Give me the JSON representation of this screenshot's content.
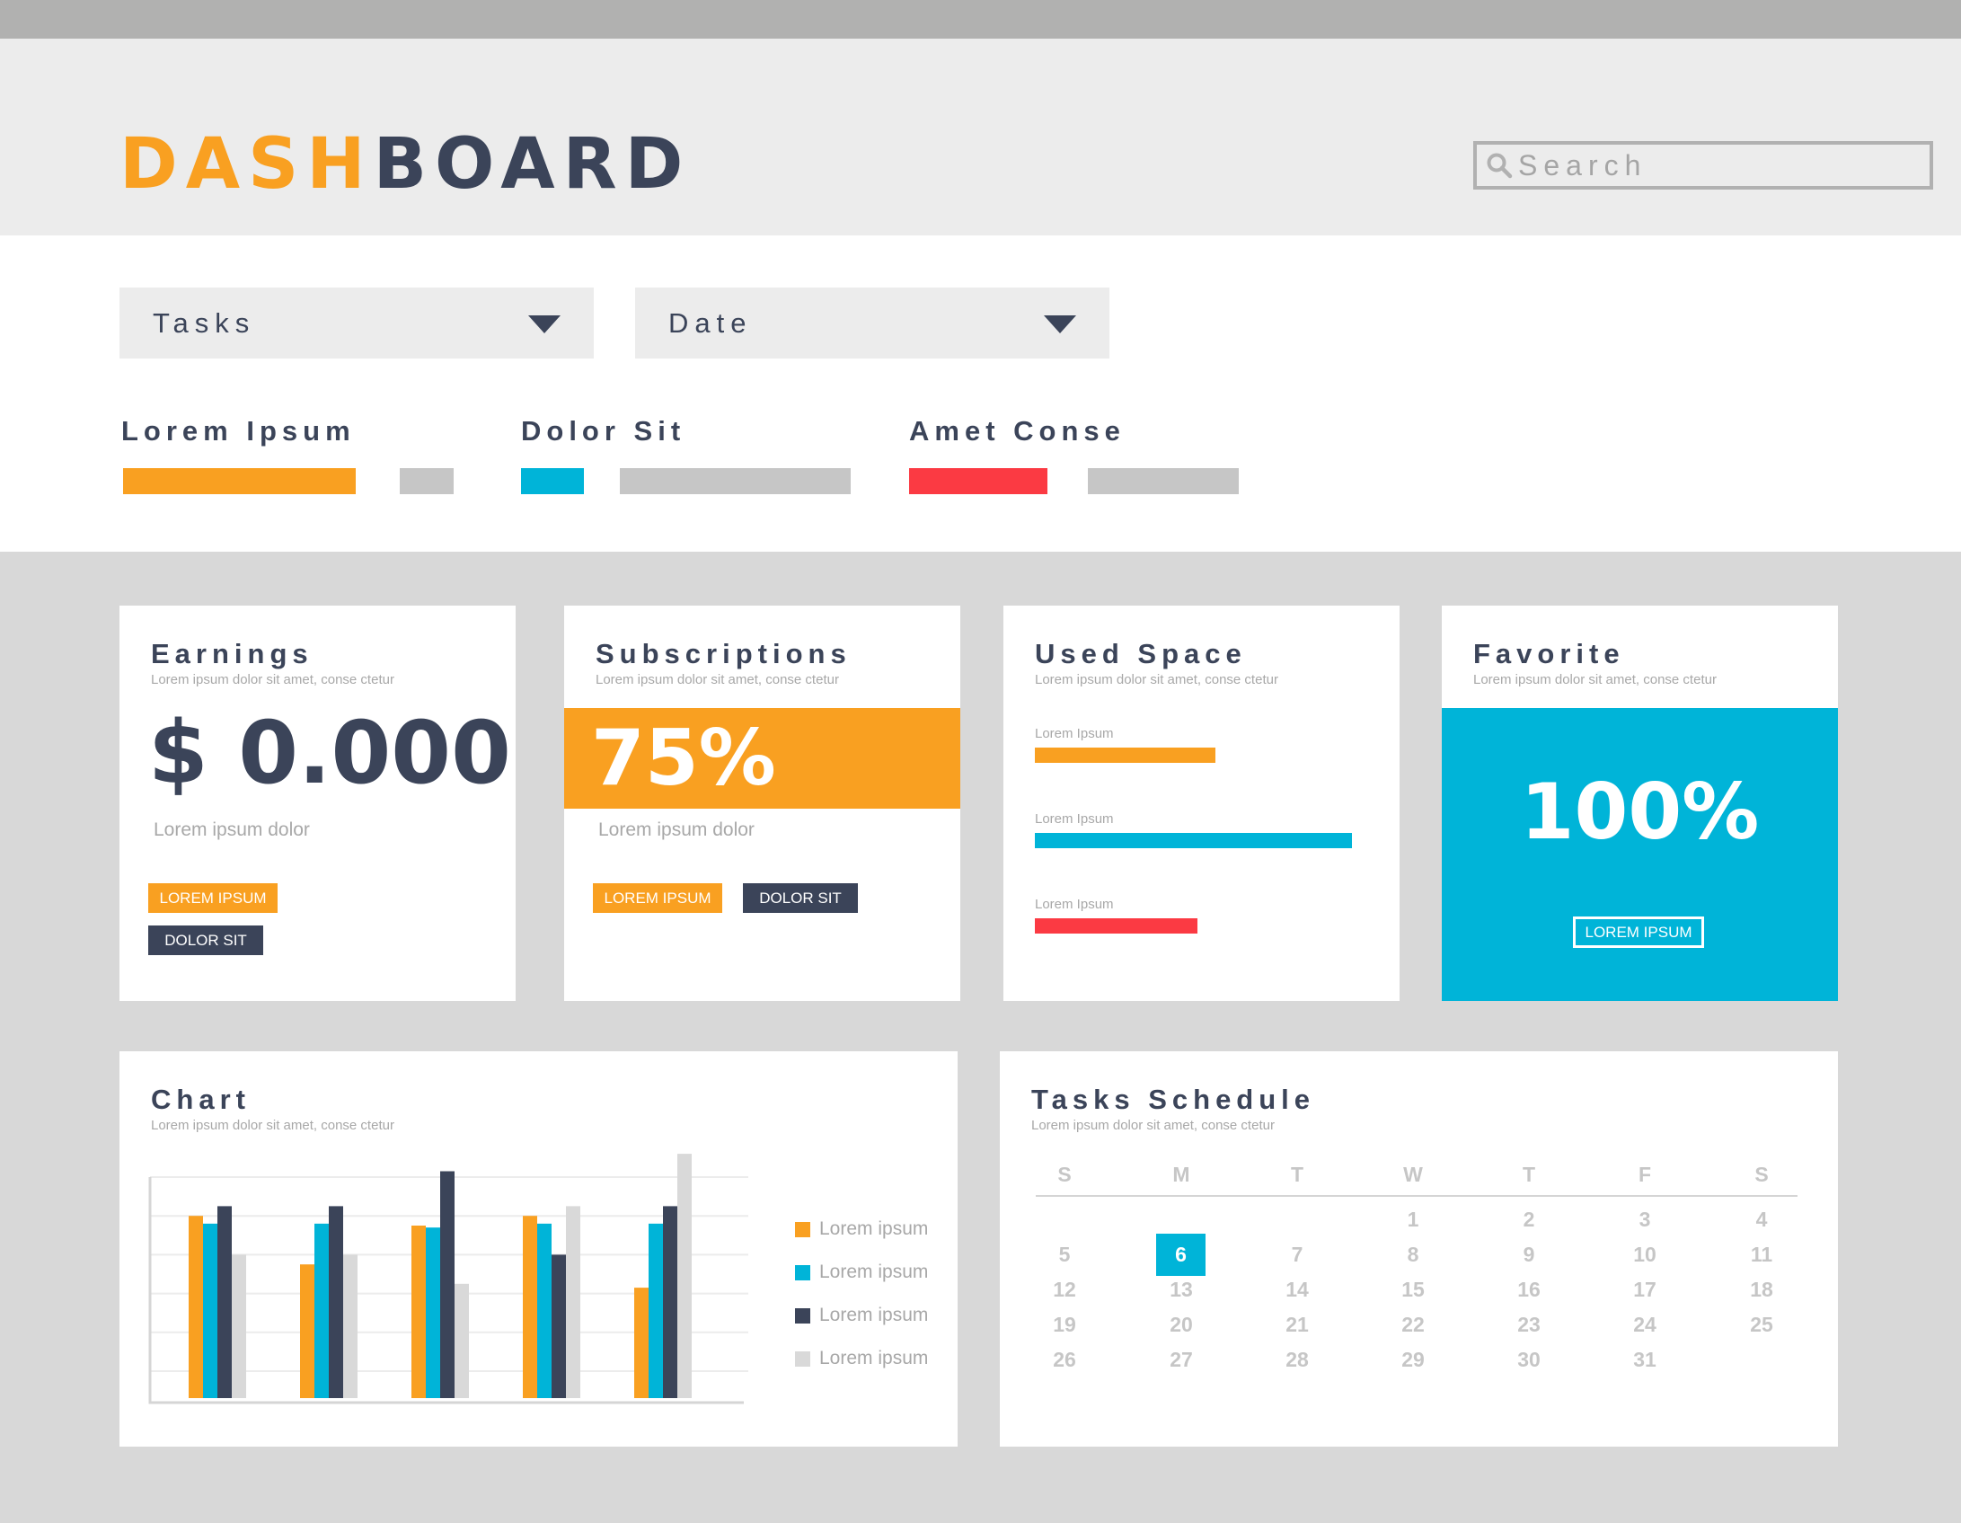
{
  "header": {
    "title_part1": "DASH",
    "title_part2": "BOARD",
    "search_placeholder": "Search"
  },
  "filters": {
    "tasks": "Tasks",
    "date": "Date"
  },
  "legend": [
    {
      "label": "Lorem Ipsum",
      "color": "#f9a021"
    },
    {
      "label": "Dolor Sit",
      "color": "#00b4d8"
    },
    {
      "label": "Amet Conse",
      "color": "#fb3a43"
    }
  ],
  "cards": {
    "earnings": {
      "title": "Earnings",
      "subtitle": "Lorem ipsum dolor sit amet, conse ctetur",
      "value": "$ 0.000",
      "note": "Lorem ipsum dolor",
      "btn1": "LOREM IPSUM",
      "btn2": "DOLOR SIT"
    },
    "subscriptions": {
      "title": "Subscriptions",
      "subtitle": "Lorem ipsum dolor sit amet, conse ctetur",
      "value": "75%",
      "note": "Lorem ipsum dolor",
      "btn1": "LOREM IPSUM",
      "btn2": "DOLOR SIT"
    },
    "used_space": {
      "title": "Used Space",
      "subtitle": "Lorem ipsum dolor sit amet, conse ctetur",
      "bars": [
        {
          "label": "Lorem Ipsum",
          "fraction": 0.41,
          "color": "#f9a021"
        },
        {
          "label": "Lorem Ipsum",
          "fraction": 0.72,
          "color": "#00b4d8"
        },
        {
          "label": "Lorem Ipsum",
          "fraction": 0.37,
          "color": "#fb3a43"
        }
      ]
    },
    "favorite": {
      "title": "Favorite",
      "subtitle": "Lorem ipsum dolor sit amet, conse ctetur",
      "value": "100%",
      "btn": "LOREM IPSUM"
    }
  },
  "chart": {
    "title": "Chart",
    "subtitle": "Lorem ipsum dolor sit amet, conse ctetur"
  },
  "chart_data": {
    "type": "bar",
    "categories": [
      "",
      "",
      "",
      "",
      ""
    ],
    "ylim": [
      0,
      10
    ],
    "grid": true,
    "legend_position": "right",
    "series": [
      {
        "name": "Lorem ipsum",
        "color": "#f9a021",
        "values": [
          8.0,
          5.5,
          7.5,
          8.0,
          4.3
        ]
      },
      {
        "name": "Lorem ipsum",
        "color": "#00b4d8",
        "values": [
          7.6,
          7.6,
          7.4,
          7.6,
          7.6
        ]
      },
      {
        "name": "Lorem ipsum",
        "color": "#3b4459",
        "values": [
          8.5,
          8.5,
          10.3,
          6.0,
          8.5
        ]
      },
      {
        "name": "Lorem ipsum",
        "color": "#d9d9d9",
        "values": [
          6.0,
          6.0,
          4.5,
          8.5,
          11.2
        ]
      }
    ]
  },
  "schedule": {
    "title": "Tasks Schedule",
    "subtitle": "Lorem ipsum dolor sit amet, conse ctetur",
    "weekdays": [
      "S",
      "M",
      "T",
      "W",
      "T",
      "F",
      "S"
    ],
    "start_offset": 3,
    "days_in_month": 31,
    "selected_day": 6,
    "selected_color": "#00b4d8"
  }
}
